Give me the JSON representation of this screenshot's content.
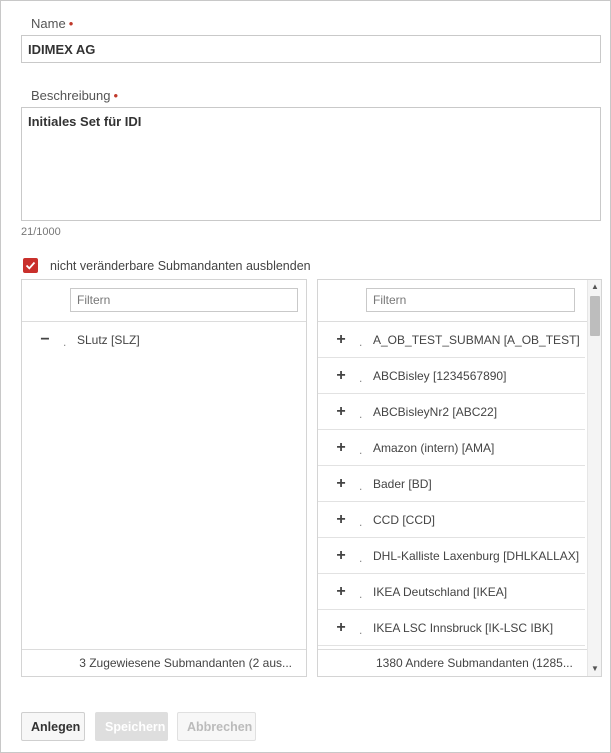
{
  "form": {
    "name_label": "Name",
    "name_value": "IDIMEX AG",
    "required_marker": "•",
    "description_label": "Beschreibung",
    "description_value": "Initiales Set für IDI",
    "char_counter": "21/1000",
    "hide_checkbox_label": "nicht veränderbare Submandanten ausblenden",
    "hide_checkbox_checked": true
  },
  "left_panel": {
    "filter_placeholder": "Filtern",
    "items": [
      {
        "sign": "−",
        "dot": ".",
        "label": "SLutz [SLZ]"
      }
    ],
    "footer": "3 Zugewiesene Submandanten (2 aus..."
  },
  "right_panel": {
    "filter_placeholder": "Filtern",
    "items": [
      {
        "sign": "+",
        "dot": ".",
        "label": "A_OB_TEST_SUBMAN [A_OB_TEST]"
      },
      {
        "sign": "+",
        "dot": ".",
        "label": "ABCBisley [1234567890]"
      },
      {
        "sign": "+",
        "dot": ".",
        "label": "ABCBisleyNr2 [ABC22]"
      },
      {
        "sign": "+",
        "dot": ".",
        "label": "Amazon (intern) [AMA]"
      },
      {
        "sign": "+",
        "dot": ".",
        "label": "Bader [BD]"
      },
      {
        "sign": "+",
        "dot": ".",
        "label": "CCD [CCD]"
      },
      {
        "sign": "+",
        "dot": ".",
        "label": "DHL-Kalliste Laxenburg [DHLKALLAX]"
      },
      {
        "sign": "+",
        "dot": ".",
        "label": "IKEA Deutschland [IKEA]"
      },
      {
        "sign": "+",
        "dot": ".",
        "label": "IKEA LSC Innsbruck [IK-LSC IBK]"
      }
    ],
    "footer": "1380 Andere Submandanten (1285..."
  },
  "buttons": {
    "create": "Anlegen",
    "save": "Speichern",
    "cancel": "Abbrechen"
  },
  "colors": {
    "accent_red": "#c9302c",
    "border": "#c9c9c9"
  }
}
